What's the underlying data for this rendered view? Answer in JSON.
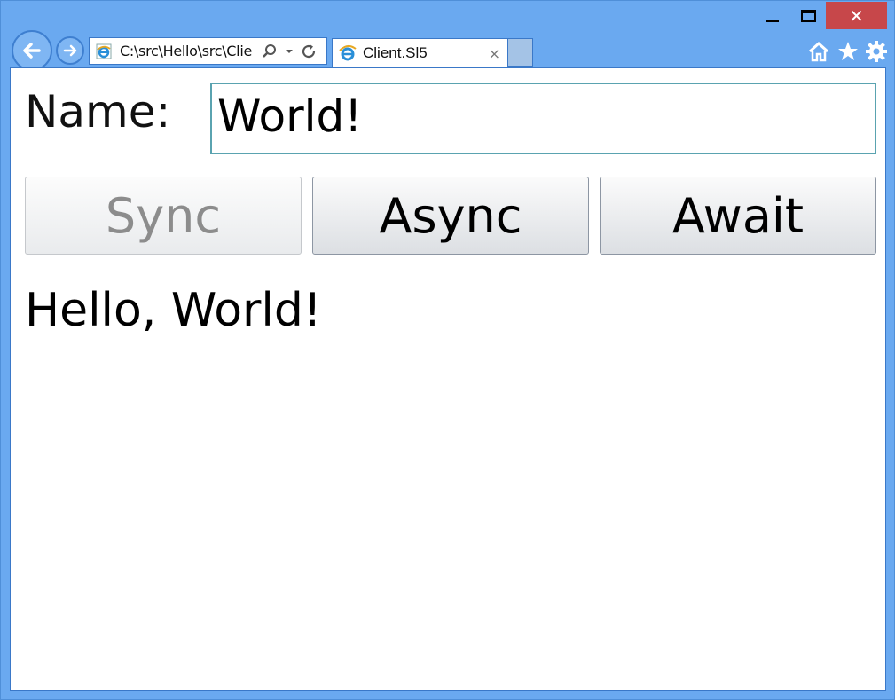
{
  "window": {
    "minimize_icon": "minimize-icon",
    "maximize_icon": "maximize-icon",
    "close_glyph": "✕"
  },
  "browser": {
    "address": "C:\\src\\Hello\\src\\Clie",
    "tab_title": "Client.Sl5",
    "tab_close": "×"
  },
  "app": {
    "name_label": "Name:",
    "name_value": "World!",
    "buttons": {
      "sync": "Sync",
      "async": "Async",
      "await": "Await"
    },
    "result": "Hello, World!"
  },
  "colors": {
    "frame": "#6aa9f0",
    "close": "#c7474a",
    "input_border": "#5aa3b0",
    "disabled_text": "#8c8c8c"
  }
}
